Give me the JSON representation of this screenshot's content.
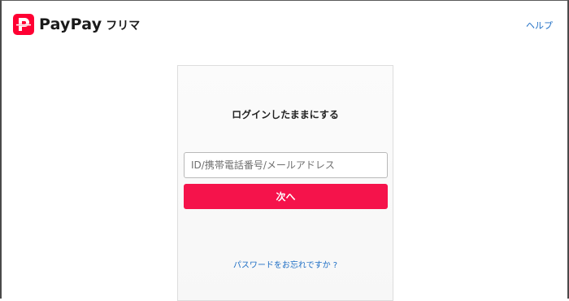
{
  "header": {
    "brand_name": "PayPay",
    "brand_sub": "フリマ",
    "help_label": "ヘルプ"
  },
  "login": {
    "title": "ログインしたままにする",
    "id_placeholder": "ID/携帯電話番号/メールアドレス",
    "id_value": "",
    "next_label": "次へ",
    "forgot_password_label": "パスワードをお忘れですか ?"
  },
  "colors": {
    "brand_red": "#ff0033",
    "button_red": "#f5134b",
    "link_blue": "#1f6fc5"
  },
  "icons": {
    "logo": "paypay-logo-icon"
  }
}
